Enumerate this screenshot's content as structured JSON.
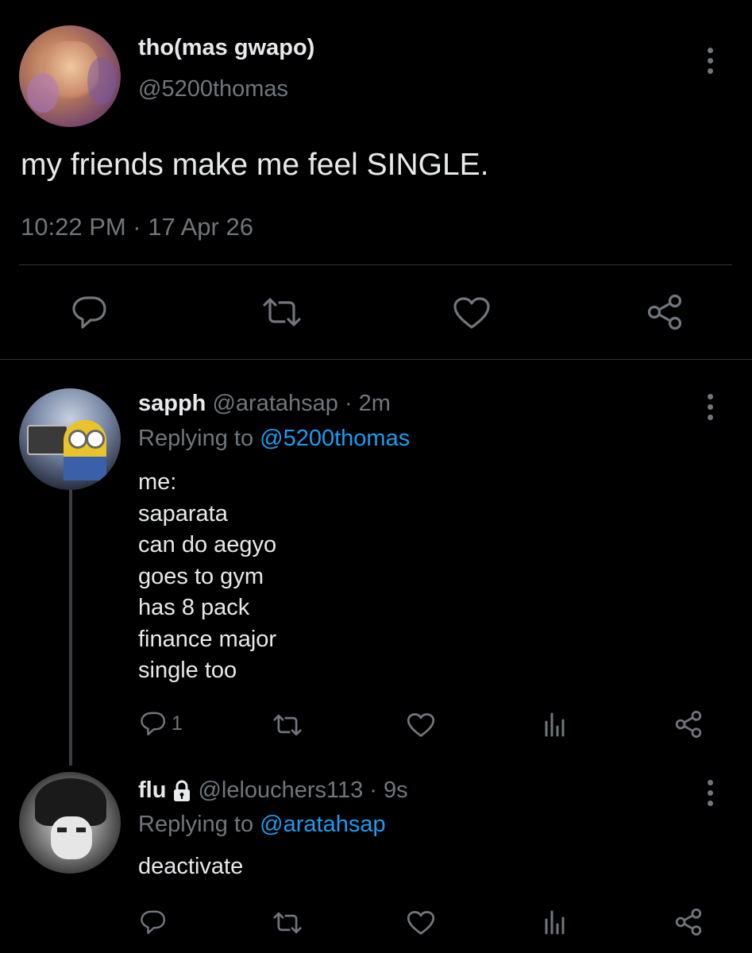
{
  "main_tweet": {
    "display_name": "tho(mas gwapo)",
    "handle": "@5200thomas",
    "text": "my friends make me feel SINGLE.",
    "timestamp": "10:22 PM · 17 Apr 26"
  },
  "replies": [
    {
      "display_name": "sapph",
      "handle": "@aratahsap",
      "time": "· 2m",
      "replying_prefix": "Replying to",
      "replying_to": "@5200thomas",
      "lines": [
        "me:",
        "saparata",
        "can do aegyo",
        "goes to gym",
        "has 8 pack",
        "finance major",
        "single too"
      ],
      "reply_count": "1"
    },
    {
      "display_name": "flu",
      "protected": true,
      "handle": "@lelouchers113",
      "time": "· 9s",
      "replying_prefix": "Replying to",
      "replying_to": "@aratahsap",
      "lines": [
        "deactivate"
      ],
      "reply_count": ""
    }
  ],
  "icons": {
    "reply": "reply-icon",
    "retweet": "retweet-icon",
    "like": "heart-icon",
    "share": "share-icon",
    "views": "views-icon",
    "more": "more-icon",
    "lock": "lock-icon"
  },
  "colors": {
    "background": "#000000",
    "text": "#e7e9ea",
    "muted": "#71767b",
    "link": "#1d9bf0",
    "divider": "#2f3336"
  }
}
